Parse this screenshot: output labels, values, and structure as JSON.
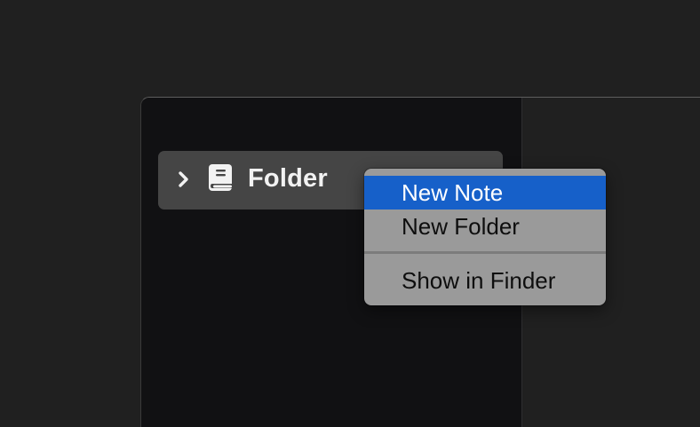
{
  "sidebar": {
    "folder": {
      "label": "Folder",
      "expand_icon": "chevron-right-icon",
      "icon": "book-icon"
    }
  },
  "context_menu": {
    "items": [
      {
        "label": "New Note",
        "highlighted": true
      },
      {
        "label": "New Folder",
        "highlighted": false
      },
      {
        "label": "Show in Finder",
        "highlighted": false
      }
    ]
  },
  "colors": {
    "background": "#202020",
    "sidebar_background": "#111113",
    "row_selected": "#454545",
    "menu_background": "#9a9a9a",
    "menu_highlight": "#1660c9"
  }
}
